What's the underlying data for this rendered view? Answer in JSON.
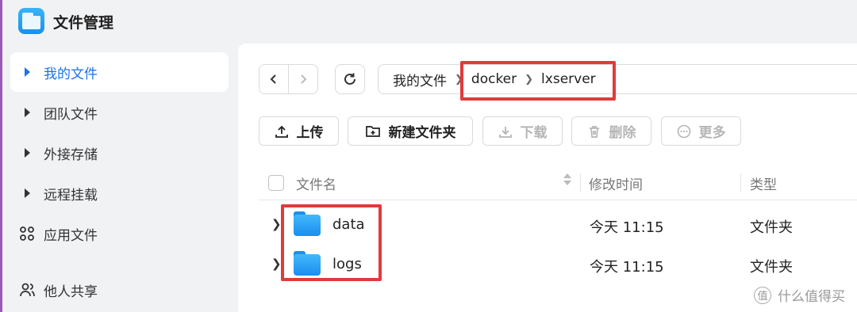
{
  "app": {
    "title": "文件管理",
    "icon": "folder-app-icon",
    "accent": "#1a73e8"
  },
  "sidebar": {
    "items": [
      {
        "label": "我的文件",
        "icon": "caret-right-icon",
        "active": true
      },
      {
        "label": "团队文件",
        "icon": "caret-right-icon",
        "active": false
      },
      {
        "label": "外接存储",
        "icon": "caret-right-icon",
        "active": false
      },
      {
        "label": "远程挂载",
        "icon": "caret-right-icon",
        "active": false
      },
      {
        "label": "应用文件",
        "icon": "grid-apps-icon",
        "active": false
      },
      {
        "label": "他人共享",
        "icon": "users-icon",
        "active": false
      }
    ]
  },
  "nav": {
    "back_icon": "chevron-left-icon",
    "forward_icon": "chevron-right-icon",
    "refresh_icon": "refresh-icon"
  },
  "breadcrumb": {
    "items": [
      "我的文件",
      "docker",
      "lxserver"
    ],
    "separator_icon": "chevron-right-icon"
  },
  "toolbar": {
    "upload_label": "上传",
    "new_folder_label": "新建文件夹",
    "download_label": "下载",
    "delete_label": "删除",
    "more_label": "更多"
  },
  "table": {
    "columns": {
      "name": "文件名",
      "mtime": "修改时间",
      "type": "类型"
    },
    "rows": [
      {
        "name": "data",
        "mtime": "今天 11:15",
        "type": "文件夹",
        "icon": "folder-icon"
      },
      {
        "name": "logs",
        "mtime": "今天 11:15",
        "type": "文件夹",
        "icon": "folder-icon"
      }
    ]
  },
  "highlight_color": "#e03b3b",
  "watermark": {
    "text": "什么值得买",
    "badge": "值"
  }
}
